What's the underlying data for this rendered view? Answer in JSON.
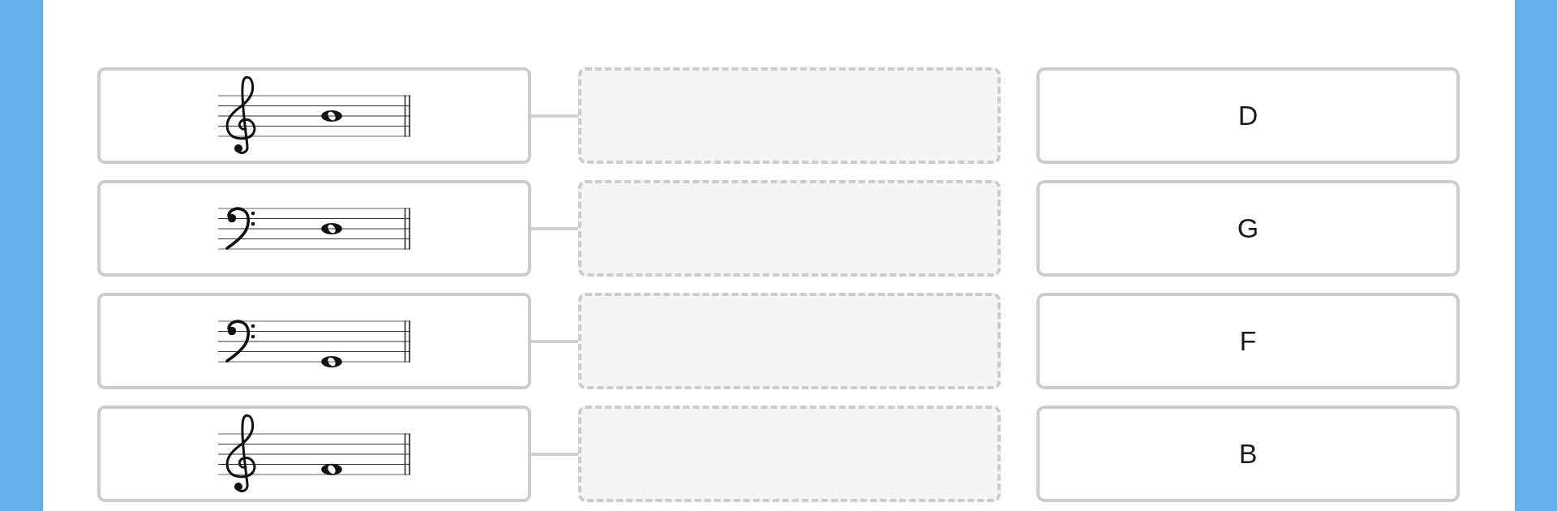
{
  "prompts": [
    {
      "kind": "treble",
      "note": {
        "kind": "line3"
      }
    },
    {
      "kind": "bass",
      "note": {
        "kind": "line3"
      }
    },
    {
      "kind": "bass",
      "note": {
        "kind": "line1"
      }
    },
    {
      "kind": "treble",
      "note": {
        "kind": "space1"
      }
    }
  ],
  "answers": [
    {
      "label": "D"
    },
    {
      "label": "G"
    },
    {
      "label": "F"
    },
    {
      "label": "B"
    }
  ]
}
